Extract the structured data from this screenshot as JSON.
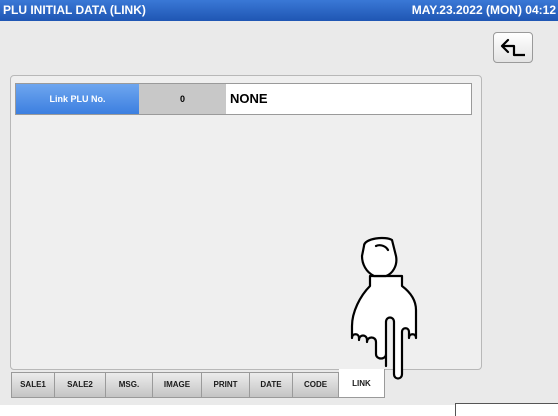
{
  "header": {
    "title": "PLU INITIAL DATA (LINK)",
    "datetime": "MAY.23.2022 (MON) 04:12"
  },
  "toolbar": {
    "back_icon": "return-arrow-icon"
  },
  "field": {
    "label": "Link PLU No.",
    "value": "0",
    "name": "NONE"
  },
  "tabs": [
    {
      "label": "SALE1",
      "active": false
    },
    {
      "label": "SALE2",
      "active": false
    },
    {
      "label": "MSG.",
      "active": false
    },
    {
      "label": "IMAGE",
      "active": false
    },
    {
      "label": "PRINT",
      "active": false
    },
    {
      "label": "DATE",
      "active": false
    },
    {
      "label": "CODE",
      "active": false
    },
    {
      "label": "LINK",
      "active": true
    }
  ],
  "overlay": {
    "icon": "pointing-hand-icon"
  },
  "colors": {
    "title_bar": "#1f56b3",
    "label_blue": "#4f8fe6",
    "background": "#eaeaea"
  }
}
